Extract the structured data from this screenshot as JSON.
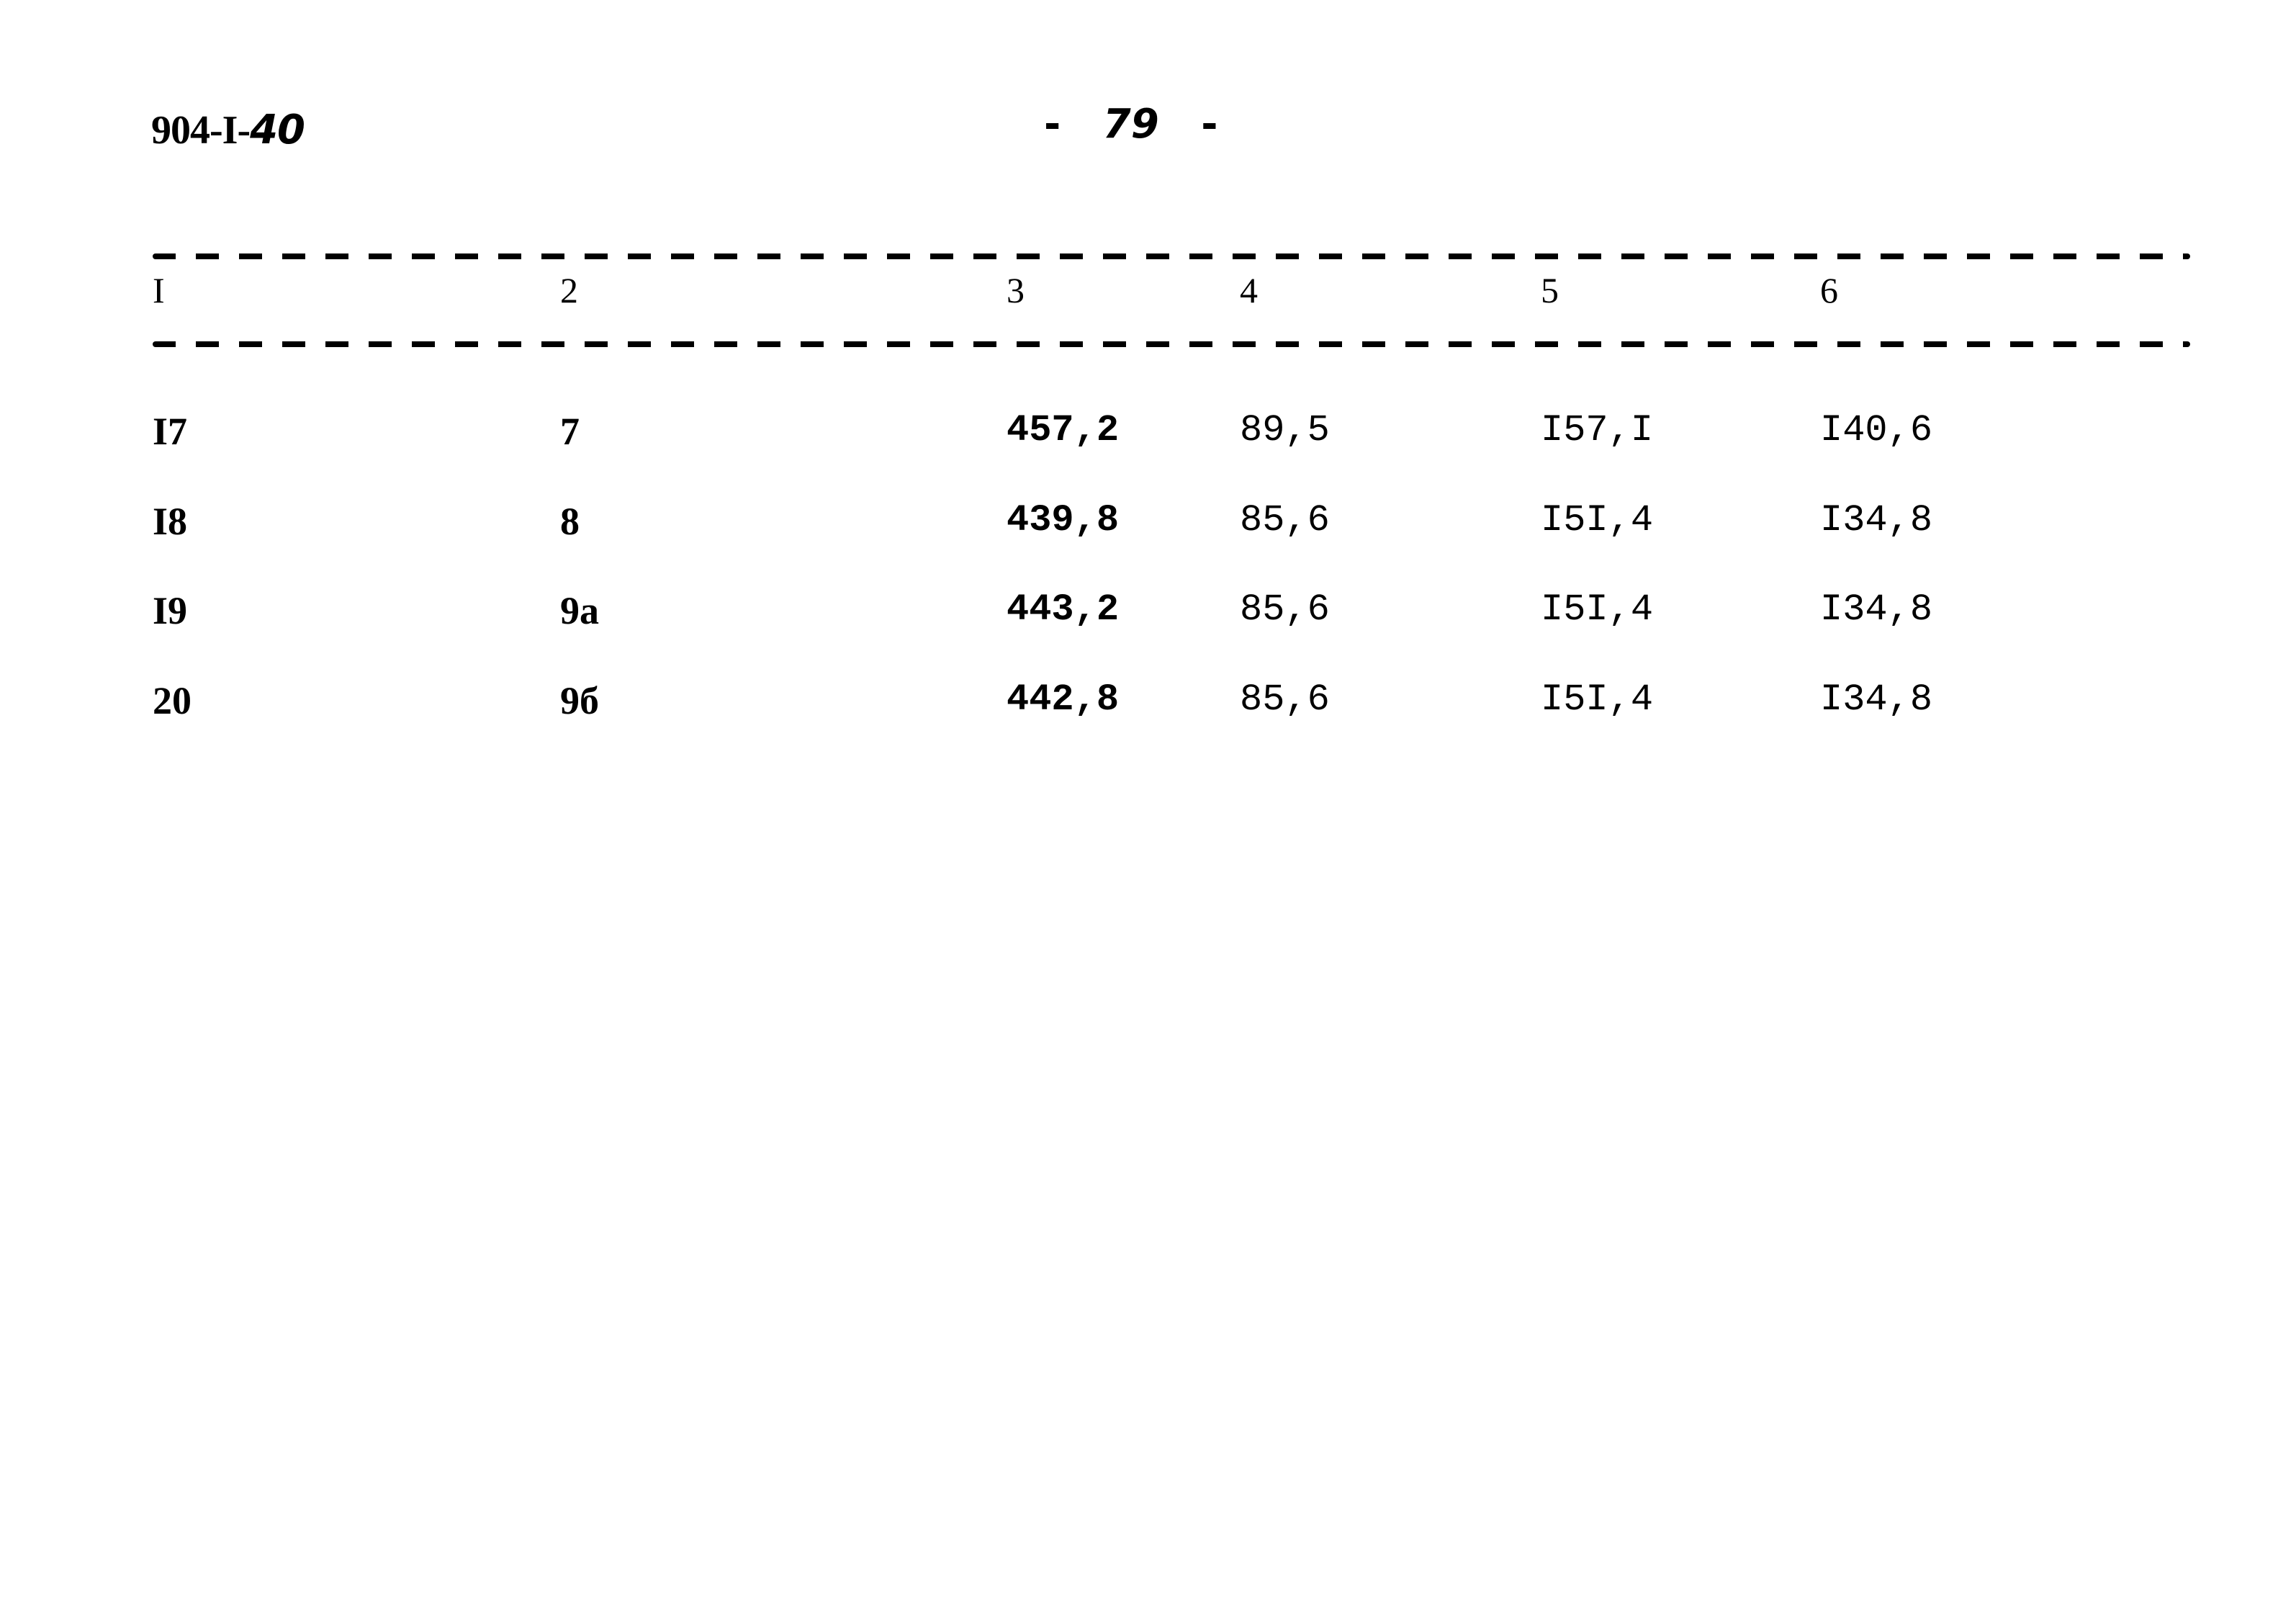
{
  "document": {
    "code_prefix": "904-I-",
    "code_suffix": "40",
    "page_number": "79",
    "page_dash": "-"
  },
  "table": {
    "columns": [
      "I",
      "2",
      "3",
      "4",
      "5",
      "6"
    ],
    "rows": [
      [
        "I7",
        "7",
        "457,2",
        "89,5",
        "I57,I",
        "I40,6"
      ],
      [
        "I8",
        "8",
        "439,8",
        "85,6",
        "I5I,4",
        "I34,8"
      ],
      [
        "I9",
        "9а",
        "443,2",
        "85,6",
        "I5I,4",
        "I34,8"
      ],
      [
        "20",
        "9б",
        "442,8",
        "85,6",
        "I5I,4",
        "I34,8"
      ]
    ]
  }
}
